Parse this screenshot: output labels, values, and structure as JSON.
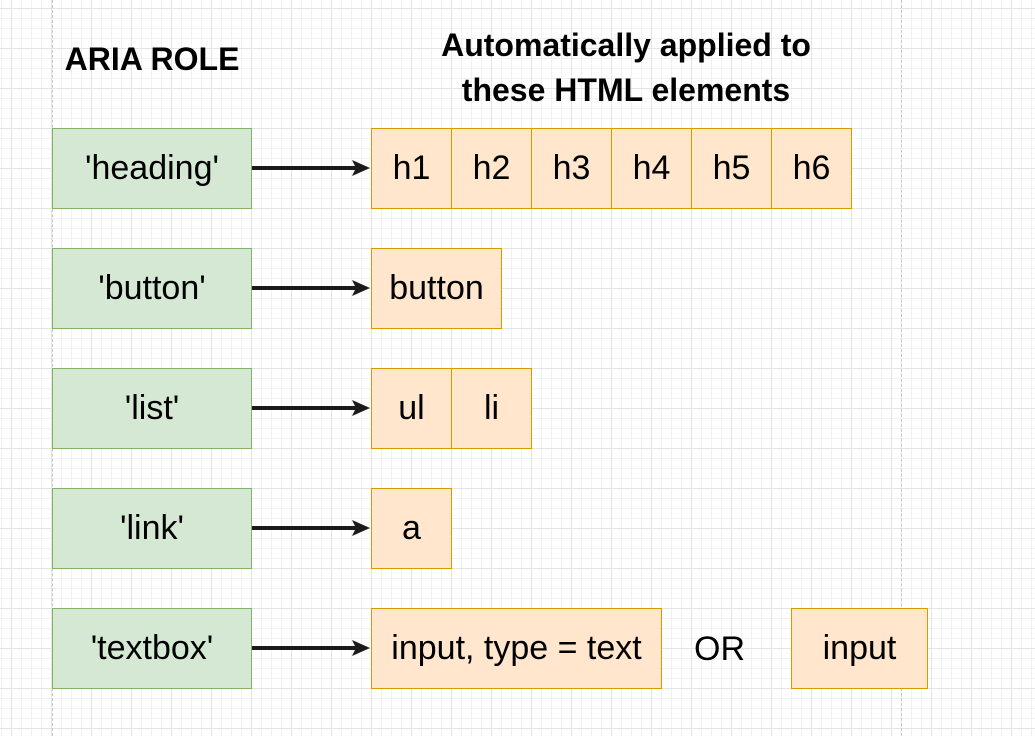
{
  "header": {
    "roles_title": "ARIA ROLE",
    "elements_title_1": "Automatically applied to",
    "elements_title_2": "these HTML elements"
  },
  "rows": [
    {
      "role": "'heading'",
      "elements": [
        "h1",
        "h2",
        "h3",
        "h4",
        "h5",
        "h6"
      ]
    },
    {
      "role": "'button'",
      "elements": [
        "button"
      ]
    },
    {
      "role": "'list'",
      "elements": [
        "ul",
        "li"
      ]
    },
    {
      "role": "'link'",
      "elements": [
        "a"
      ]
    },
    {
      "role": "'textbox'",
      "elements": [
        "input, type = text"
      ],
      "separator": "OR",
      "alternative": "input"
    }
  ],
  "colors": {
    "role_fill": "#d5e8d4",
    "role_stroke": "#82b366",
    "element_fill": "#ffe6cc",
    "element_stroke": "#d79b00"
  }
}
